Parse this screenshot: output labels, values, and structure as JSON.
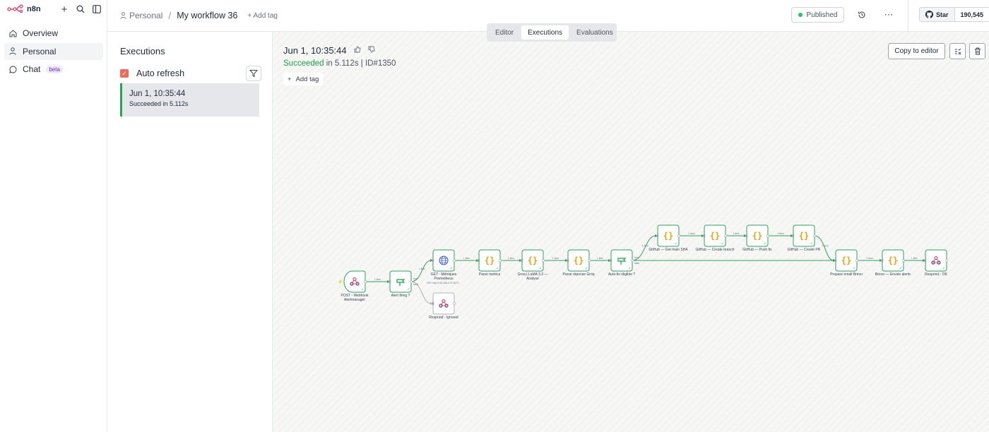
{
  "app": {
    "name": "n8n"
  },
  "sidebar": {
    "items": [
      {
        "label": "Overview"
      },
      {
        "label": "Personal"
      },
      {
        "label": "Chat",
        "badge": "beta"
      }
    ]
  },
  "header": {
    "project": "Personal",
    "separator": "/",
    "workflow_title": "My workflow 36",
    "add_tag": "+ Add tag",
    "status": "Published",
    "github": {
      "star": "Star",
      "count": "190,545"
    }
  },
  "tabs": [
    {
      "label": "Editor"
    },
    {
      "label": "Executions"
    },
    {
      "label": "Evaluations"
    }
  ],
  "executions_panel": {
    "title": "Executions",
    "auto_refresh": "Auto refresh",
    "items": [
      {
        "date": "Jun 1, 10:35:44",
        "status": "Succeeded in 5.112s"
      }
    ]
  },
  "execution": {
    "date": "Jun 1, 10:35:44",
    "status_word": "Succeeded",
    "status_rest": "in 5.112s | ID#1350",
    "add_tag": "Add tag",
    "copy_button": "Copy to editor"
  },
  "workflow": {
    "nodes": [
      {
        "name": "POST - Webhook Alertmanager",
        "lines": [
          "POST - Webhook",
          "Alertmanager"
        ],
        "icon": "webhook",
        "trigger": true
      },
      {
        "name": "Alert firing ?",
        "lines": [
          "Alert firing ?"
        ],
        "icon": "if"
      },
      {
        "name": "GET - Métriques Prometheus",
        "lines": [
          "GET - Métriques",
          "Prometheus"
        ],
        "sub": "GET: http://192.168.0.37:9171...",
        "icon": "globe"
      },
      {
        "name": "Respond - Ignored",
        "lines": [
          "Respond - Ignored"
        ],
        "icon": "webhook",
        "gray": true
      },
      {
        "name": "Parse metrics",
        "lines": [
          "Parse metrics"
        ],
        "icon": "code"
      },
      {
        "name": "Groq LLaMA 3.3 — Analyse",
        "lines": [
          "Groq LLaMA 3.3 —",
          "Analyse"
        ],
        "icon": "code"
      },
      {
        "name": "Parse réponse Groq",
        "lines": [
          "Parse réponse Groq"
        ],
        "icon": "code"
      },
      {
        "name": "Auto-fix éligible ?",
        "lines": [
          "Auto-fix éligible ?"
        ],
        "icon": "if"
      },
      {
        "name": "GitHub — Get main SHA",
        "lines": [
          "GitHub — Get main SHA"
        ],
        "icon": "code"
      },
      {
        "name": "GitHub — Create branch",
        "lines": [
          "GitHub — Create branch"
        ],
        "icon": "code"
      },
      {
        "name": "GitHub — Push fix",
        "lines": [
          "GitHub — Push fix"
        ],
        "icon": "code"
      },
      {
        "name": "GitHub — Create PR",
        "lines": [
          "GitHub — Create PR"
        ],
        "icon": "code"
      },
      {
        "name": "Prepare email Brevo",
        "lines": [
          "Prepare email Brevo"
        ],
        "icon": "code"
      },
      {
        "name": "Brevo — Envoie alerte",
        "lines": [
          "Brevo — Envoie alerte"
        ],
        "icon": "code"
      },
      {
        "name": "Respond - OK",
        "lines": [
          "Respond - OK"
        ],
        "icon": "webhook"
      }
    ],
    "edges": [
      {
        "from": 0,
        "to": 1,
        "label": "1 item"
      },
      {
        "from": 1,
        "to": 2,
        "label": "1 item",
        "branch": "true"
      },
      {
        "from": 1,
        "to": 3,
        "branch": "false",
        "gray": true
      },
      {
        "from": 2,
        "to": 4,
        "label": "1 item"
      },
      {
        "from": 4,
        "to": 5,
        "label": "1 item"
      },
      {
        "from": 5,
        "to": 6,
        "label": "1 item"
      },
      {
        "from": 6,
        "to": 7,
        "label": "1 item"
      },
      {
        "from": 7,
        "to": 8,
        "label": "1 item",
        "branch": "true"
      },
      {
        "from": 7,
        "to": 12,
        "branch": "false"
      },
      {
        "from": 8,
        "to": 9,
        "label": "1 item"
      },
      {
        "from": 9,
        "to": 10,
        "label": "1 item"
      },
      {
        "from": 10,
        "to": 11,
        "label": "1 item"
      },
      {
        "from": 11,
        "to": 12,
        "label": "1 item"
      },
      {
        "from": 12,
        "to": 13,
        "label": "1 item"
      },
      {
        "from": 13,
        "to": 14,
        "label": "1 item"
      }
    ]
  },
  "colors": {
    "success": "#29a35a",
    "accent": "#ea4b71",
    "checkbox": "#ef6b57",
    "code_icon": "#f59e0b",
    "globe_icon": "#3b5bdb",
    "if_icon": "#16a34a"
  }
}
